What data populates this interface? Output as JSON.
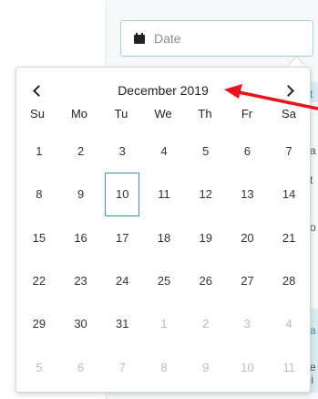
{
  "date_field": {
    "placeholder": "Date",
    "icon": "calendar-icon"
  },
  "side_snippets": [
    "t",
    "a",
    "t",
    "o",
    "a",
    "e",
    "ti"
  ],
  "calendar": {
    "month_label": "December 2019",
    "prev_icon": "chevron-left-icon",
    "next_icon": "chevron-right-icon",
    "weekdays": [
      "Su",
      "Mo",
      "Tu",
      "We",
      "Th",
      "Fr",
      "Sa"
    ],
    "weeks": [
      [
        {
          "d": "1",
          "m": false
        },
        {
          "d": "2",
          "m": false
        },
        {
          "d": "3",
          "m": false
        },
        {
          "d": "4",
          "m": false
        },
        {
          "d": "5",
          "m": false
        },
        {
          "d": "6",
          "m": false
        },
        {
          "d": "7",
          "m": false
        }
      ],
      [
        {
          "d": "8",
          "m": false
        },
        {
          "d": "9",
          "m": false
        },
        {
          "d": "10",
          "m": false,
          "today": true
        },
        {
          "d": "11",
          "m": false
        },
        {
          "d": "12",
          "m": false
        },
        {
          "d": "13",
          "m": false
        },
        {
          "d": "14",
          "m": false
        }
      ],
      [
        {
          "d": "15",
          "m": false
        },
        {
          "d": "16",
          "m": false
        },
        {
          "d": "17",
          "m": false
        },
        {
          "d": "18",
          "m": false
        },
        {
          "d": "19",
          "m": false
        },
        {
          "d": "20",
          "m": false
        },
        {
          "d": "21",
          "m": false
        }
      ],
      [
        {
          "d": "22",
          "m": false
        },
        {
          "d": "23",
          "m": false
        },
        {
          "d": "24",
          "m": false
        },
        {
          "d": "25",
          "m": false
        },
        {
          "d": "26",
          "m": false
        },
        {
          "d": "27",
          "m": false
        },
        {
          "d": "28",
          "m": false
        }
      ],
      [
        {
          "d": "29",
          "m": false
        },
        {
          "d": "30",
          "m": false
        },
        {
          "d": "31",
          "m": false
        },
        {
          "d": "1",
          "m": true
        },
        {
          "d": "2",
          "m": true
        },
        {
          "d": "3",
          "m": true
        },
        {
          "d": "4",
          "m": true
        }
      ],
      [
        {
          "d": "5",
          "m": true
        },
        {
          "d": "6",
          "m": true
        },
        {
          "d": "7",
          "m": true
        },
        {
          "d": "8",
          "m": true
        },
        {
          "d": "9",
          "m": true
        },
        {
          "d": "10",
          "m": true
        },
        {
          "d": "11",
          "m": true
        }
      ]
    ]
  },
  "colors": {
    "accent": "#3c8fa8",
    "arrow": "#e8141b",
    "muted": "#b8bcc0"
  }
}
